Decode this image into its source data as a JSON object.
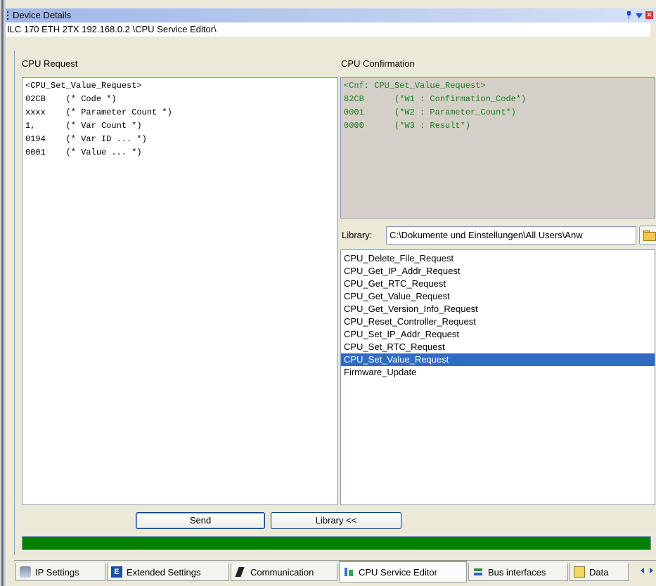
{
  "window": {
    "title": "Device Details",
    "path": "ILC 170 ETH 2TX 192.168.0.2 \\CPU Service Editor\\"
  },
  "request": {
    "label": "CPU Request",
    "lines": [
      "<CPU_Set_Value_Request>",
      "02CB    (* Code *)",
      "xxxx    (* Parameter Count *)",
      "1,      (* Var Count *)",
      "0194    (* Var ID ... *)",
      "0001    (* Value ... *)"
    ]
  },
  "confirmation": {
    "label": "CPU Confirmation",
    "lines": [
      "<Cnf: CPU_Set_Value_Request>",
      "82CB      (*W1 : Confirmation_Code*)",
      "0001      (*W2 : Parameter_Count*)",
      "0000      (*W3 : Result*)"
    ]
  },
  "library": {
    "label": "Library:",
    "path": "C:\\Dokumente und Einstellungen\\All Users\\Anw",
    "items": [
      "CPU_Delete_File_Request",
      "CPU_Get_IP_Addr_Request",
      "CPU_Get_RTC_Request",
      "CPU_Get_Value_Request",
      "CPU_Get_Version_Info_Request",
      "CPU_Reset_Controller_Request",
      "CPU_Set_IP_Addr_Request",
      "CPU_Set_RTC_Request",
      "CPU_Set_Value_Request",
      "Firmware_Update"
    ],
    "selected_index": 8
  },
  "buttons": {
    "send": "Send",
    "library": "Library <<"
  },
  "progress": {
    "value": 1.0,
    "color": "#008000"
  },
  "tabs": [
    {
      "label": "IP Settings",
      "icon": "network-icon"
    },
    {
      "label": "Extended Settings",
      "icon": "extended-settings-icon"
    },
    {
      "label": "Communication",
      "icon": "communication-icon"
    },
    {
      "label": "CPU Service Editor",
      "icon": "cpu-service-icon",
      "active": true
    },
    {
      "label": "Bus interfaces",
      "icon": "bus-interfaces-icon"
    },
    {
      "label": "Data",
      "icon": "data-icon"
    }
  ],
  "colors": {
    "selection": "#316ac5",
    "confirmation_text": "#1e7d1e",
    "active_tab_accent": "#e68b2c"
  }
}
